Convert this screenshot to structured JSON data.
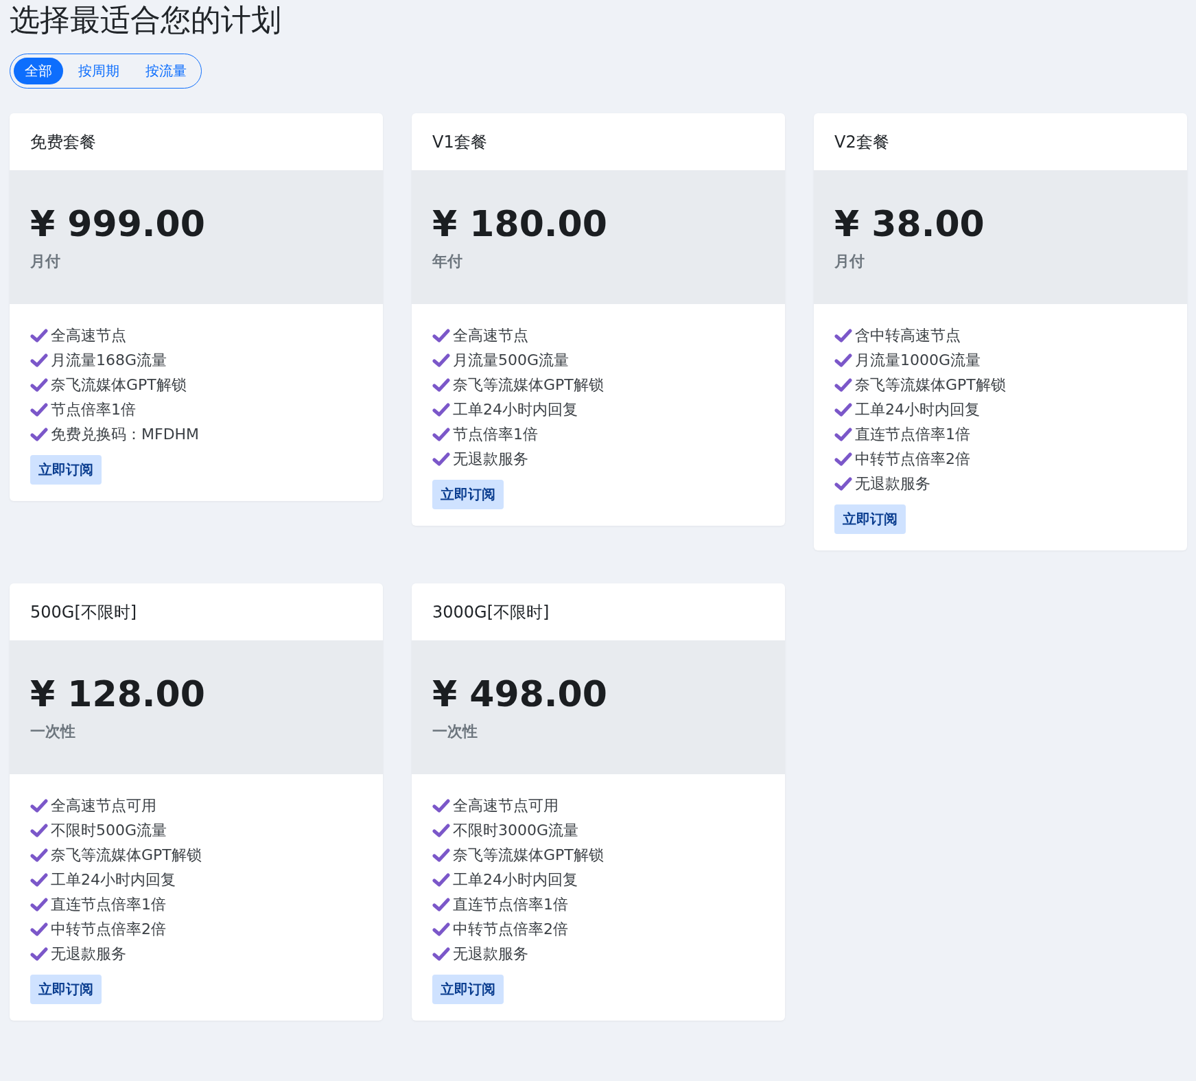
{
  "title": "选择最适合您的计划",
  "tabs": [
    {
      "label": "全部",
      "selected": true
    },
    {
      "label": "按周期",
      "selected": false
    },
    {
      "label": "按流量",
      "selected": false
    }
  ],
  "plans": [
    {
      "name": "免费套餐",
      "price": "¥ 999.00",
      "period": "月付",
      "features": [
        "全高速节点",
        "月流量168G流量",
        "奈飞流媒体GPT解锁",
        "节点倍率1倍",
        "免费兑换码：MFDHM"
      ],
      "button": "立即订阅"
    },
    {
      "name": "V1套餐",
      "price": "¥ 180.00",
      "period": "年付",
      "features": [
        "全高速节点",
        "月流量500G流量",
        "奈飞等流媒体GPT解锁",
        "工单24小时内回复",
        "节点倍率1倍",
        "无退款服务"
      ],
      "button": "立即订阅"
    },
    {
      "name": "V2套餐",
      "price": "¥ 38.00",
      "period": "月付",
      "features": [
        "含中转高速节点",
        "月流量1000G流量",
        "奈飞等流媒体GPT解锁",
        "工单24小时内回复",
        "直连节点倍率1倍",
        "中转节点倍率2倍",
        "无退款服务"
      ],
      "button": "立即订阅"
    },
    {
      "name": "500G[不限时]",
      "price": "¥ 128.00",
      "period": "一次性",
      "features": [
        "全高速节点可用",
        "不限时500G流量",
        "奈飞等流媒体GPT解锁",
        "工单24小时内回复",
        "直连节点倍率1倍",
        "中转节点倍率2倍",
        "无退款服务"
      ],
      "button": "立即订阅"
    },
    {
      "name": "3000G[不限时]",
      "price": "¥ 498.00",
      "period": "一次性",
      "features": [
        "全高速节点可用",
        "不限时3000G流量",
        "奈飞等流媒体GPT解锁",
        "工单24小时内回复",
        "直连节点倍率1倍",
        "中转节点倍率2倍",
        "无退款服务"
      ],
      "button": "立即订阅"
    }
  ]
}
